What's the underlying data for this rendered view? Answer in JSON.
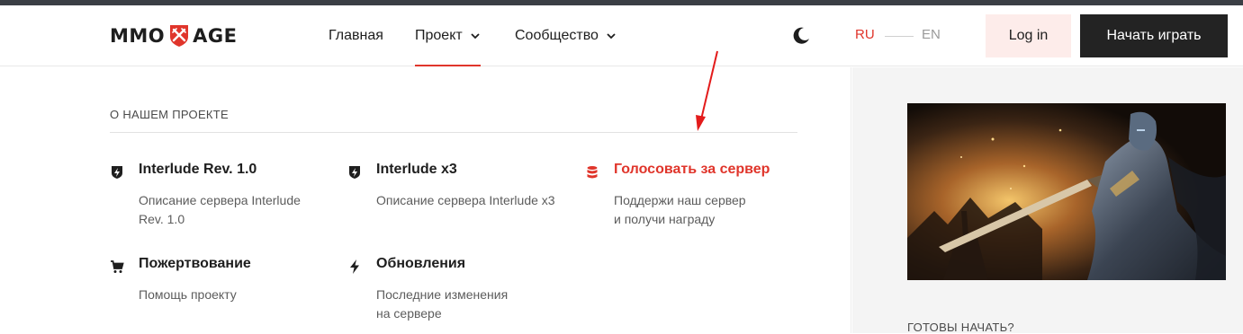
{
  "header": {
    "logo_left": "MMO",
    "logo_right": "AGE",
    "nav": [
      {
        "label": "Главная"
      },
      {
        "label": "Проект"
      },
      {
        "label": "Сообщество"
      }
    ],
    "lang_ru": "RU",
    "lang_en": "EN",
    "login_label": "Log in",
    "play_label": "Начать играть"
  },
  "mega_menu": {
    "section_title": "О НАШЕМ ПРОЕКТЕ",
    "items": [
      {
        "icon": "shield-bolt-icon",
        "title": "Interlude Rev. 1.0",
        "desc": "Описание сервера Interlude Rev. 1.0"
      },
      {
        "icon": "shield-bolt-icon",
        "title": "Interlude x3",
        "desc": "Описание сервера Interlude x3"
      },
      {
        "icon": "database-icon",
        "title": "Голосовать за сервер",
        "line1": "Поддержи наш сервер",
        "line2": "и получи награду"
      },
      {
        "icon": "cart-icon",
        "title": "Пожертвование",
        "desc": "Помощь проекту"
      },
      {
        "icon": "lightning-icon",
        "title": "Обновления",
        "line1": "Последние изменения",
        "line2": "на сервере"
      }
    ]
  },
  "sidebar": {
    "promo_image": "fantasy-knight-artwork",
    "ready_label": "ГОТОВЫ НАЧАТЬ?"
  },
  "colors": {
    "accent": "#e0352b",
    "dark_button": "#232323",
    "login_bg": "#fdecea"
  }
}
